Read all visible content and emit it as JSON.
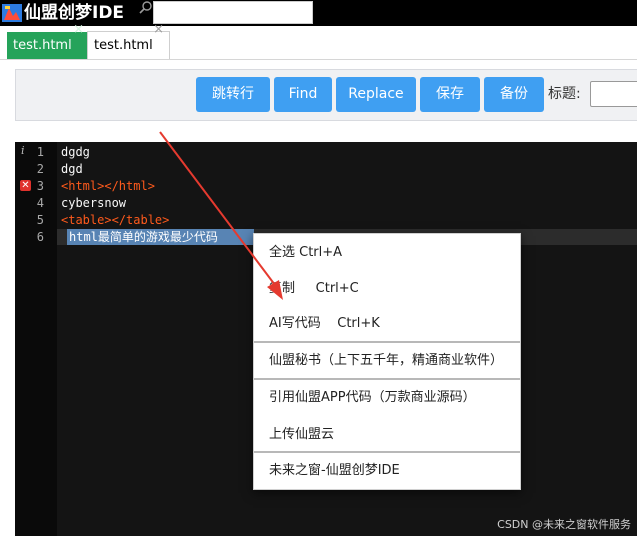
{
  "app": {
    "title": "仙盟创梦IDE",
    "search_value": ""
  },
  "tabs": [
    {
      "label": "test.html",
      "close": "×"
    },
    {
      "label": "test.html",
      "close": "×"
    }
  ],
  "toolbar": {
    "goto_label": "跳转行",
    "find_label": "Find",
    "replace_label": "Replace",
    "save_label": "保存",
    "backup_label": "备份",
    "title_label": "标题:",
    "title_value": ""
  },
  "editor": {
    "line_numbers": [
      "1",
      "2",
      "3",
      "4",
      "5",
      "6"
    ],
    "gutter_markers": {
      "info": "i",
      "error": "✕"
    },
    "lines": {
      "l1": "dgdg",
      "l2": "dgd",
      "l3": "<html></html>",
      "l4": "cybersnow",
      "l5": "<table></table>",
      "l6": "html最简单的游戏最少代码"
    }
  },
  "context_menu": {
    "select_all": "全选 Ctrl+A",
    "copy": "复制     Ctrl+C",
    "ai_code": "AI写代码    Ctrl+K",
    "secretary": "仙盟秘书（上下五千年，精通商业软件）",
    "cite_app": "引用仙盟APP代码（万款商业源码）",
    "upload": "上传仙盟云",
    "future": "未来之窗-仙盟创梦IDE"
  },
  "watermark": "CSDN @未来之窗软件服务",
  "colors": {
    "accent_blue": "#3f9ff2",
    "active_tab": "#25a35a",
    "editor_bg": "#141414",
    "tag_color": "#ff5a1c",
    "selection": "#5884b4",
    "annotation_arrow": "#e53a2f"
  }
}
